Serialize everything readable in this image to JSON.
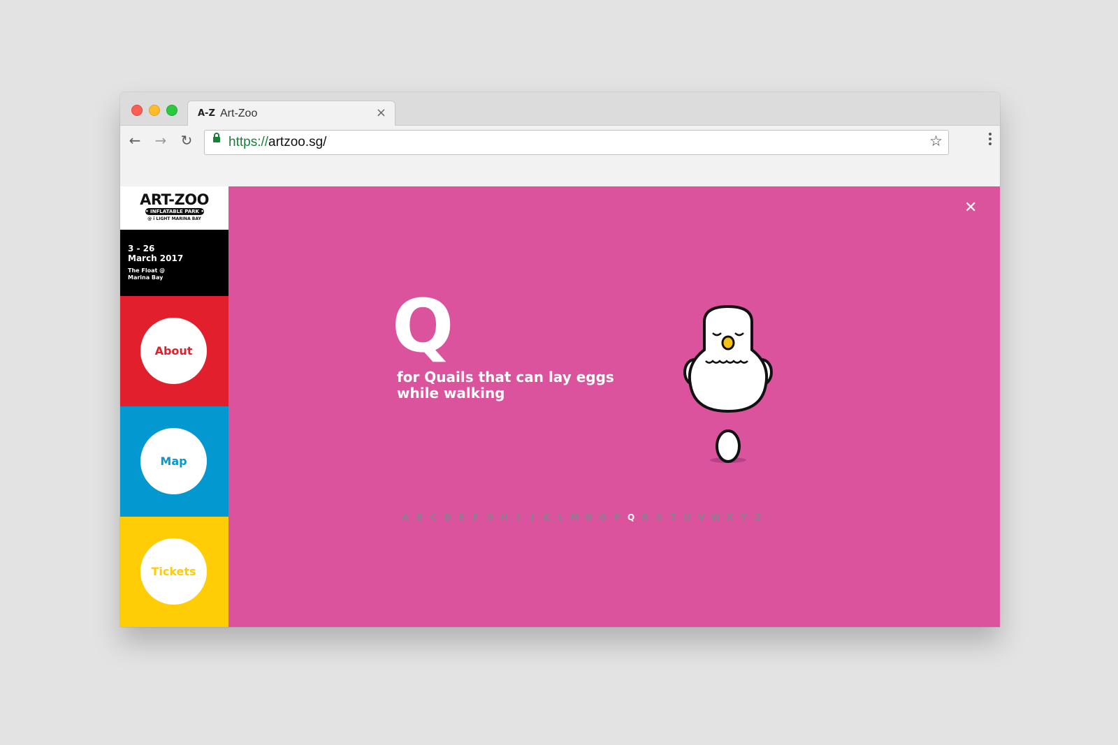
{
  "browser": {
    "tab": {
      "favicon_text": "A-Z",
      "title": "Art-Zoo",
      "close_glyph": "×"
    },
    "nav": {
      "back_glyph": "←",
      "forward_glyph": "→",
      "reload_glyph": "↻"
    },
    "address": {
      "scheme": "https://",
      "host": "artzoo.sg/"
    },
    "star_glyph": "☆"
  },
  "sidebar": {
    "logo": {
      "title": "ART-ZOO",
      "pill": "• INFLATABLE PARK •",
      "sub": "@ i LIGHT MARINA BAY"
    },
    "event": {
      "range": "3 - 26",
      "month": "March 2017",
      "venue_line1": "The Float @",
      "venue_line2": "Marina Bay"
    },
    "items": [
      {
        "label": "About",
        "color": "#e21f2c"
      },
      {
        "label": "Map",
        "color": "#0398cf"
      },
      {
        "label": "Tickets",
        "color": "#ffcd05"
      }
    ]
  },
  "main": {
    "background": "#db529d",
    "close_glyph": "✕",
    "letter": "Q",
    "caption_line1": "for Quails that can lay eggs",
    "caption_line2": "while walking",
    "illustration": "quail-icon",
    "alphabet": [
      "A",
      "B",
      "C",
      "D",
      "E",
      "F",
      "G",
      "H",
      "I",
      "J",
      "K",
      "L",
      "M",
      "N",
      "O",
      "P",
      "Q",
      "R",
      "S",
      "T",
      "U",
      "V",
      "W",
      "X",
      "Y",
      "Z"
    ],
    "active_letter": "Q"
  }
}
